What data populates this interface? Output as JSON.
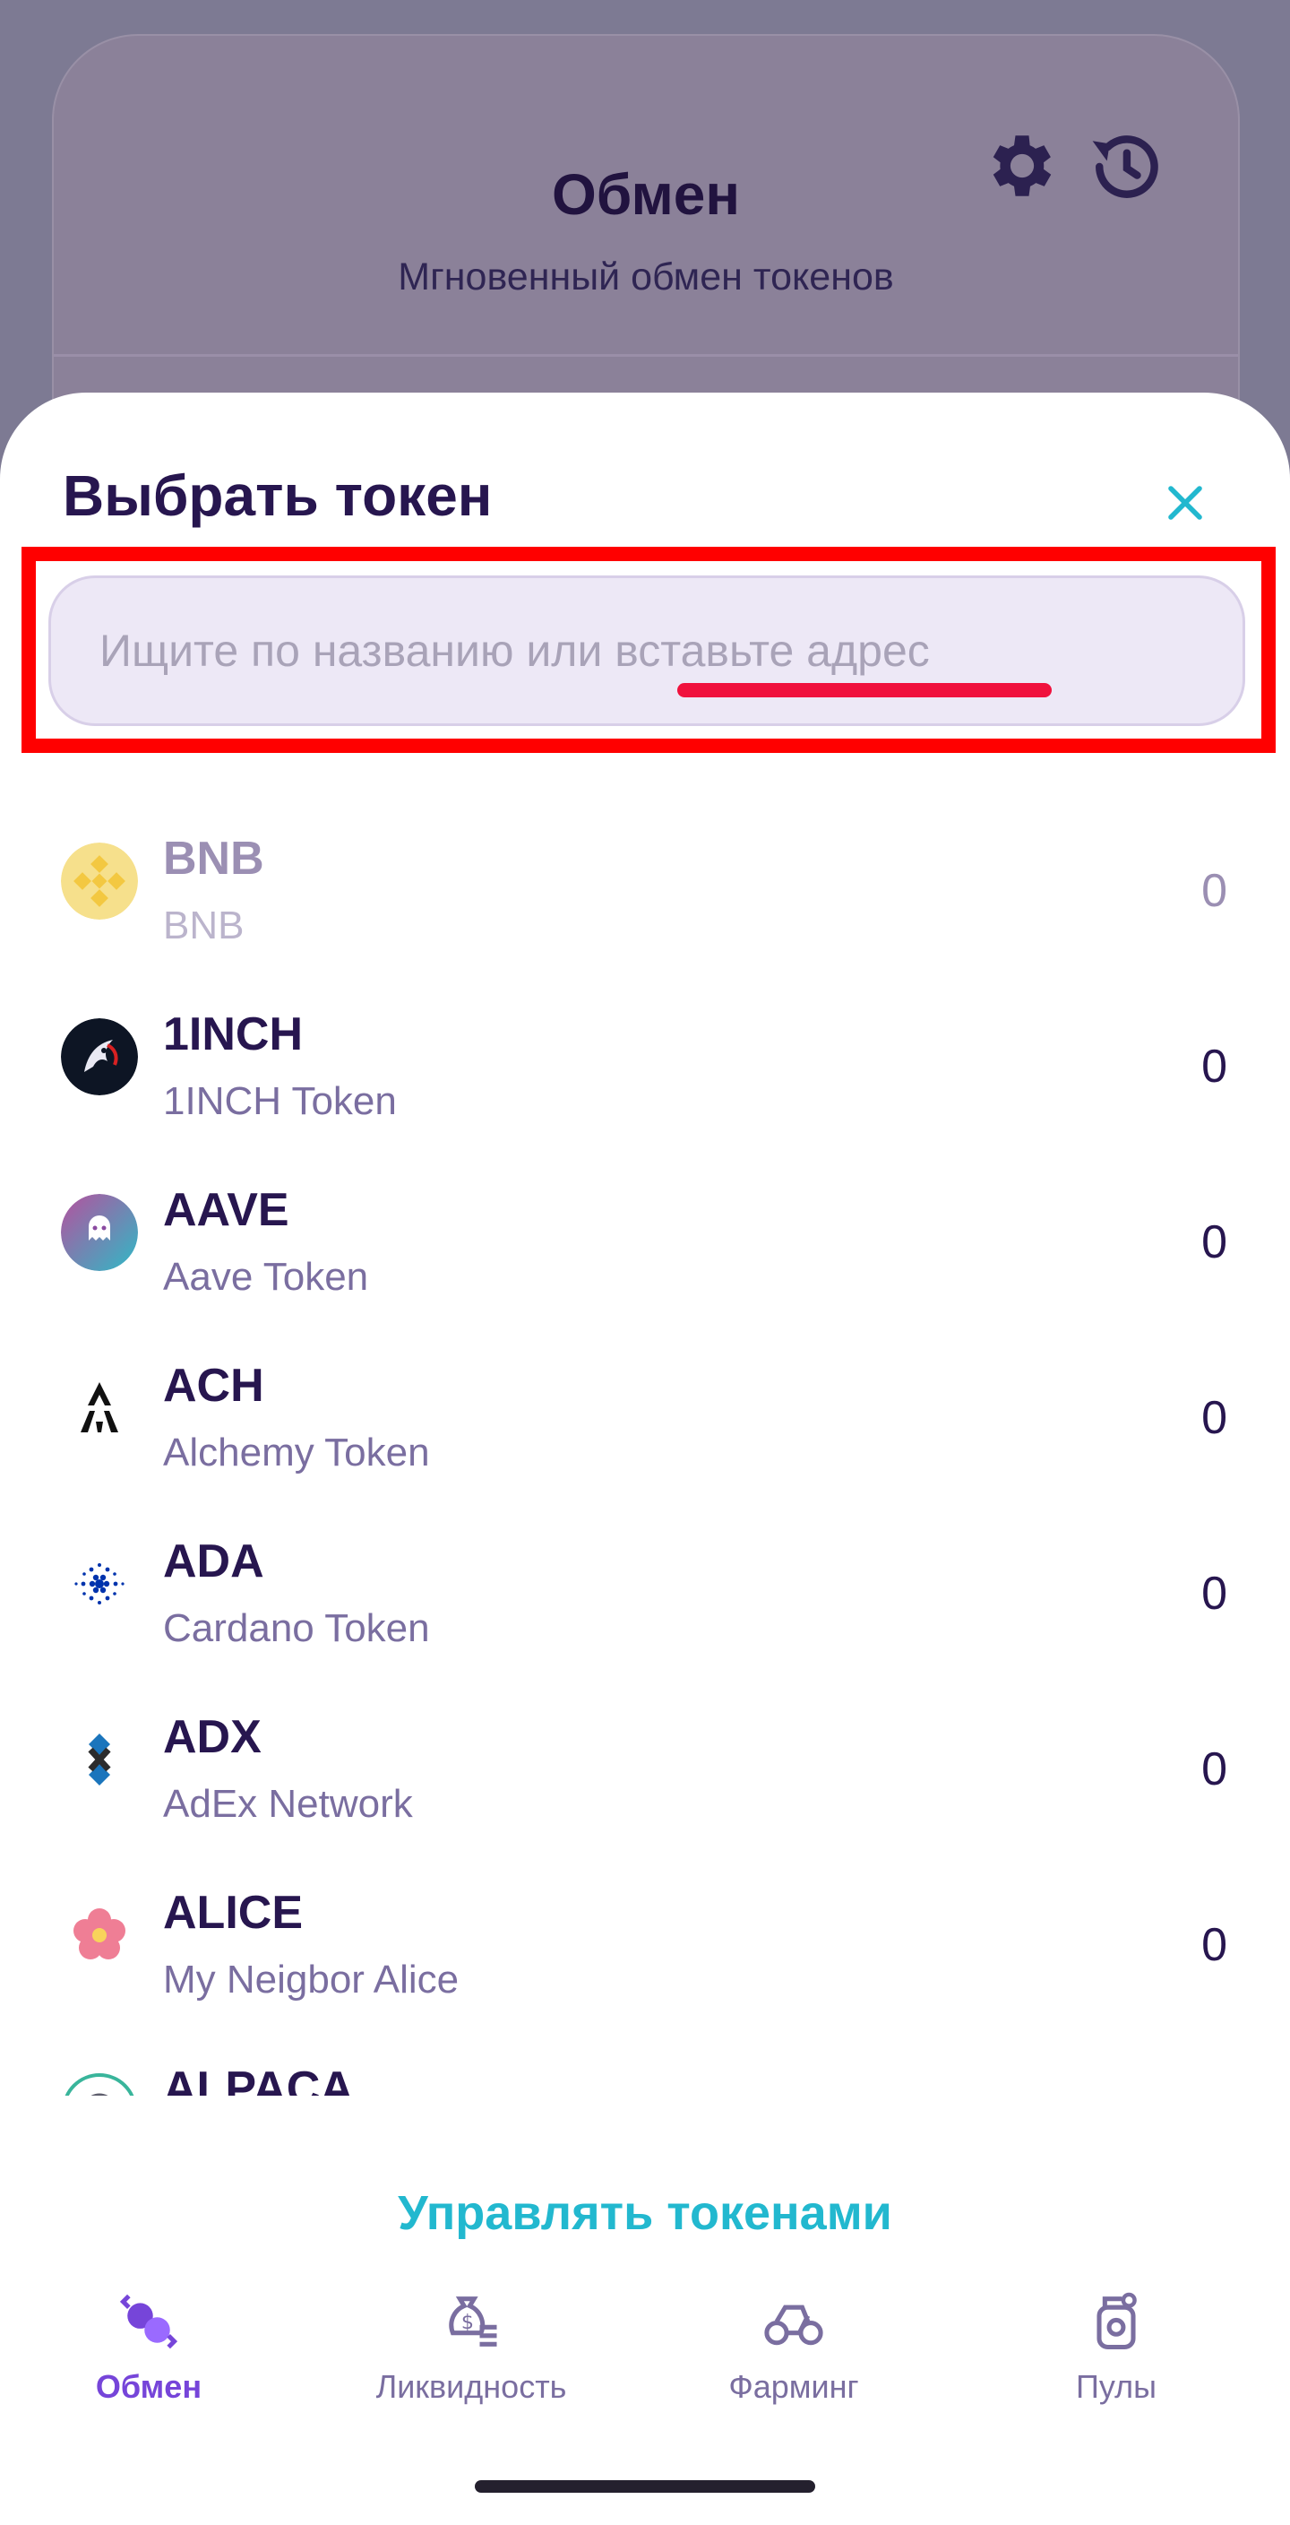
{
  "background": {
    "title": "Обмен",
    "subtitle": "Мгновенный обмен токенов"
  },
  "sheet": {
    "title": "Выбрать токен",
    "search_placeholder": "Ищите по названию или вставьте адрес",
    "search_value": ""
  },
  "tokens": [
    {
      "symbol": "BNB",
      "name": "BNB",
      "balance": "0",
      "disabled": true
    },
    {
      "symbol": "1INCH",
      "name": "1INCH Token",
      "balance": "0"
    },
    {
      "symbol": "AAVE",
      "name": "Aave Token",
      "balance": "0"
    },
    {
      "symbol": "ACH",
      "name": "Alchemy Token",
      "balance": "0"
    },
    {
      "symbol": "ADA",
      "name": "Cardano Token",
      "balance": "0"
    },
    {
      "symbol": "ADX",
      "name": "AdEx Network",
      "balance": "0"
    },
    {
      "symbol": "ALICE",
      "name": "My Neigbor Alice",
      "balance": "0"
    },
    {
      "symbol": "ALPACA",
      "name": "",
      "balance": ""
    }
  ],
  "manage_tokens_label": "Управлять токенами",
  "nav": [
    {
      "label": "Обмен",
      "icon": "swap-icon",
      "active": true
    },
    {
      "label": "Ликвидность",
      "icon": "liquidity-icon"
    },
    {
      "label": "Фарминг",
      "icon": "farming-icon"
    },
    {
      "label": "Пулы",
      "icon": "pools-icon"
    }
  ],
  "colors": {
    "accent": "#7645d9",
    "teal": "#22b8cf",
    "highlight": "#ff0000",
    "text_primary": "#27164f"
  }
}
